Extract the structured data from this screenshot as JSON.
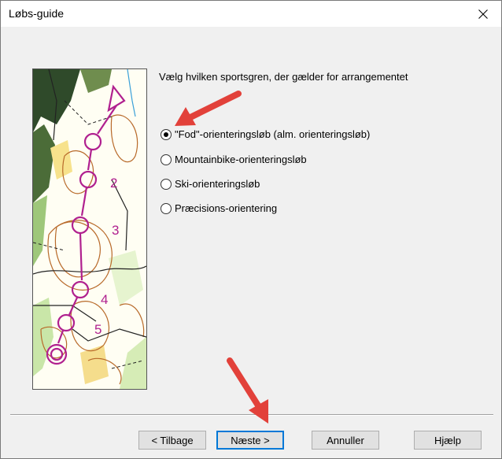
{
  "window": {
    "title": "Løbs-guide"
  },
  "content": {
    "prompt": "Vælg hvilken sportsgren, der gælder for arrangementet",
    "options": [
      {
        "label": "\"Fod\"-orienteringsløb  (alm. orienteringsløb)",
        "checked": true
      },
      {
        "label": "Mountainbike-orienteringsløb",
        "checked": false
      },
      {
        "label": "Ski-orienteringsløb",
        "checked": false
      },
      {
        "label": "Præcisions-orientering",
        "checked": false
      }
    ],
    "map_control_numbers": [
      "2",
      "3",
      "4",
      "5"
    ]
  },
  "buttons": {
    "back": "< Tilbage",
    "next": "Næste >",
    "cancel": "Annuller",
    "help": "Hjælp"
  },
  "colors": {
    "annotation_arrow": "#e2413a",
    "default_button_border": "#0078d7",
    "course_overprint": "#b0208f"
  }
}
